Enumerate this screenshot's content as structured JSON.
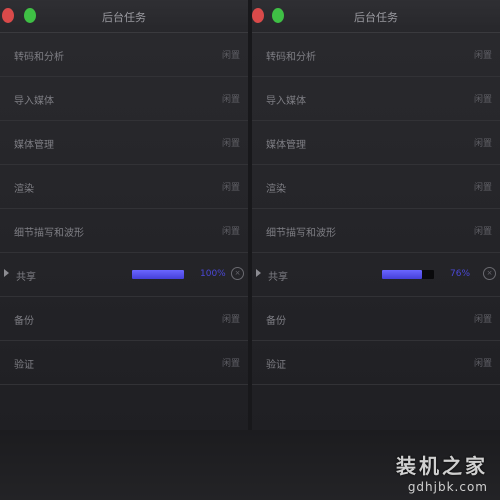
{
  "windows": [
    {
      "id": "left",
      "title": "后台任务",
      "rows": [
        {
          "label": "转码和分析",
          "status": "闲置"
        },
        {
          "label": "导入媒体",
          "status": "闲置"
        },
        {
          "label": "媒体管理",
          "status": "闲置"
        },
        {
          "label": "渲染",
          "status": "闲置"
        },
        {
          "label": "细节描写和波形",
          "status": "闲置"
        },
        {
          "label": "共享",
          "active": true,
          "progress": 1.0,
          "progress_text": "100%"
        },
        {
          "label": "备份",
          "status": "闲置"
        },
        {
          "label": "验证",
          "status": "闲置"
        }
      ]
    },
    {
      "id": "right",
      "title": "后台任务",
      "rows": [
        {
          "label": "转码和分析",
          "status": "闲置"
        },
        {
          "label": "导入媒体",
          "status": "闲置"
        },
        {
          "label": "媒体管理",
          "status": "闲置"
        },
        {
          "label": "渲染",
          "status": "闲置"
        },
        {
          "label": "细节描写和波形",
          "status": "闲置"
        },
        {
          "label": "共享",
          "active": true,
          "progress": 0.76,
          "progress_text": "76%"
        },
        {
          "label": "备份",
          "status": "闲置"
        },
        {
          "label": "验证",
          "status": "闲置"
        }
      ]
    }
  ],
  "watermark": {
    "text": "装机之家",
    "domain": "gdhjbk.com"
  },
  "colors": {
    "accent": "#4b48d6",
    "close": "#d94a4a",
    "zoom": "#3fbf45"
  },
  "icons": {
    "active_row": "disclosure-arrow-icon",
    "stop": "stop-circle-icon"
  }
}
